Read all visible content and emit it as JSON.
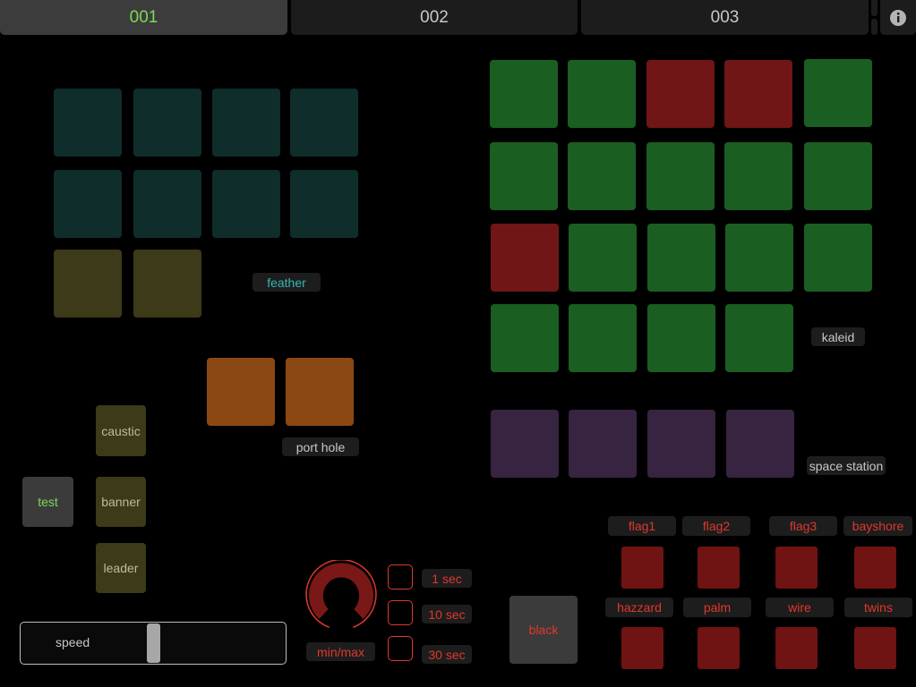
{
  "tabs": [
    {
      "label": "001",
      "active": true
    },
    {
      "label": "002",
      "active": false
    },
    {
      "label": "003",
      "active": false
    }
  ],
  "labels": {
    "feather": "feather",
    "kaleid": "kaleid",
    "port_hole": "port hole",
    "space_station": "space station"
  },
  "left_buttons": {
    "test": "test",
    "caustic": "caustic",
    "banner": "banner",
    "leader": "leader"
  },
  "speed_slider": {
    "label": "speed",
    "value": 0.5
  },
  "knob": {
    "label": "min/max"
  },
  "timers": [
    "1 sec",
    "10 sec",
    "30 sec"
  ],
  "black_button": "black",
  "flags_row1": [
    "flag1",
    "flag2",
    "flag3",
    "bayshore"
  ],
  "flags_row2": [
    "hazzard",
    "palm",
    "wire",
    "twins"
  ],
  "kaleid_grid": [
    [
      "green",
      "green",
      "red",
      "red",
      "green"
    ],
    [
      "green",
      "green",
      "green",
      "green",
      "green"
    ],
    [
      "red",
      "green",
      "green",
      "green",
      "green"
    ],
    [
      "green",
      "green",
      "green",
      "green"
    ]
  ],
  "colors": {
    "accent_green": "#7ed957",
    "accent_red": "#e0382c",
    "pad_green": "#1a5e22",
    "pad_red": "#701616",
    "pad_teal": "#0f2d2b",
    "pad_olive": "#3c3a18",
    "pad_orange": "#8c4813",
    "pad_purple": "#362440"
  }
}
